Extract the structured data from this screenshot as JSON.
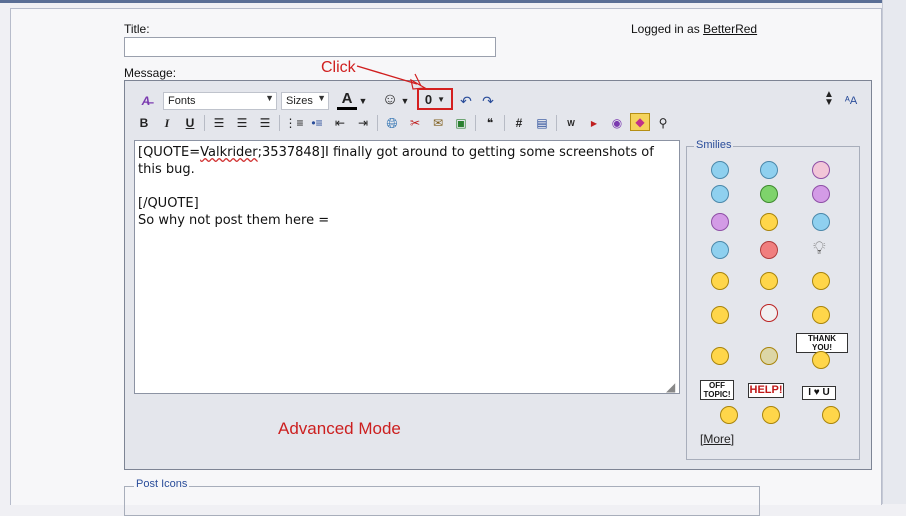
{
  "form": {
    "title_label": "Title:",
    "title_value": "",
    "message_label": "Message:",
    "logged_in_prefix": "Logged in as",
    "username": "BetterRed"
  },
  "toolbar": {
    "font_select": "Fonts",
    "size_select": "Sizes",
    "bold": "B",
    "italic": "I",
    "underline": "U",
    "text_color": "A",
    "hash": "#"
  },
  "message_lines": [
    "[QUOTE=Valkrider;3537848]I finally got around to getting some screenshots of",
    "this bug.",
    "",
    "[/QUOTE]",
    "So why not post them here ="
  ],
  "smilies": {
    "legend": "Smilies",
    "signs": {
      "thank_you": "THANK YOU!",
      "off_topic": "OFF TOPIC!",
      "help": "HELP!",
      "i_love_u": "I ♥ U"
    },
    "more_label": "More"
  },
  "annotations": {
    "click": "Click",
    "advanced_mode": "Advanced Mode"
  },
  "post_icons": {
    "legend": "Post Icons"
  },
  "colors": {
    "annotation_red": "#cc1f1f",
    "editor_bg": "#e4e6ec",
    "accent_blue": "#2a4d9a"
  }
}
